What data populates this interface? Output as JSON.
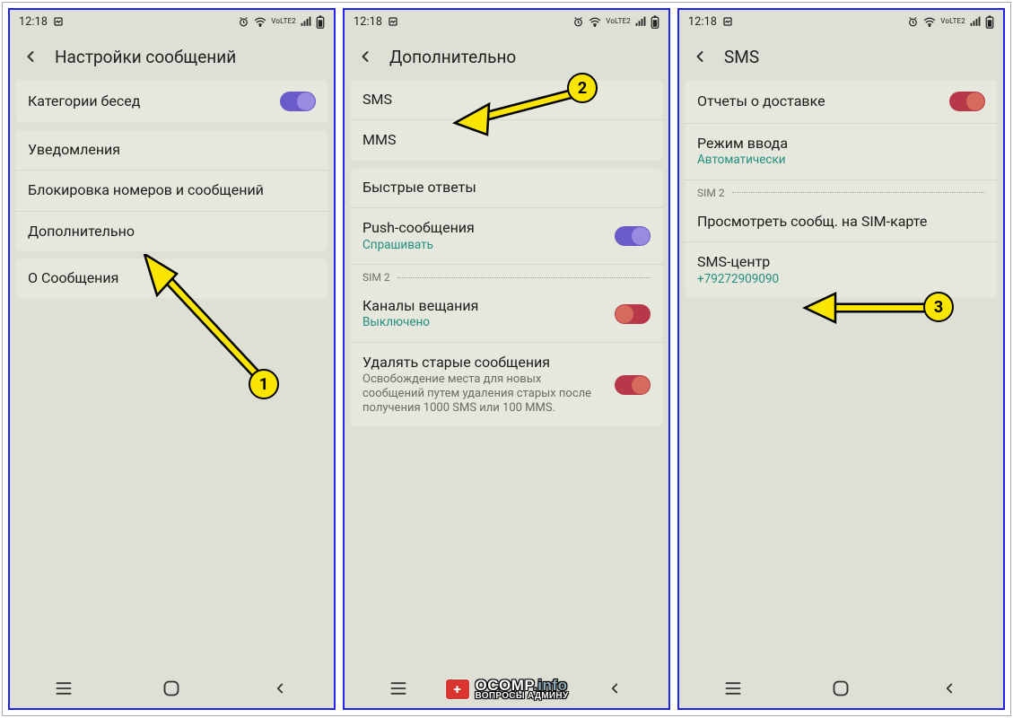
{
  "status": {
    "time": "12:18",
    "lte_label": "VoLTE2"
  },
  "screen1": {
    "title": "Настройки сообщений",
    "items": {
      "categories": "Категории бесед",
      "notifications": "Уведомления",
      "blocking": "Блокировка номеров и сообщений",
      "additional": "Дополнительно",
      "about": "О Сообщения"
    }
  },
  "screen2": {
    "title": "Дополнительно",
    "items": {
      "sms": "SMS",
      "mms": "MMS",
      "quick": "Быстрые ответы",
      "push": "Push-сообщения",
      "push_sub": "Спрашивать",
      "sim2": "SIM 2",
      "channels": "Каналы вещания",
      "channels_sub": "Выключено",
      "delete": "Удалять старые сообщения",
      "delete_desc": "Освобождение места для новых сообщений путем удаления старых после получения 1000 SMS или 100 MMS."
    }
  },
  "screen3": {
    "title": "SMS",
    "items": {
      "delivery": "Отчеты о доставке",
      "input_mode": "Режим ввода",
      "input_mode_sub": "Автоматически",
      "sim2": "SIM 2",
      "view_sim": "Просмотреть сообщ. на SIM-карте",
      "sms_center": "SMS-центр",
      "sms_center_val": "+79272909090"
    }
  },
  "markers": {
    "m1": "1",
    "m2": "2",
    "m3": "3"
  },
  "watermark": {
    "badge": "+",
    "name": "OCOMP",
    "domain": ".info",
    "sub": "ВОПРОСЫ АДМИНУ"
  }
}
